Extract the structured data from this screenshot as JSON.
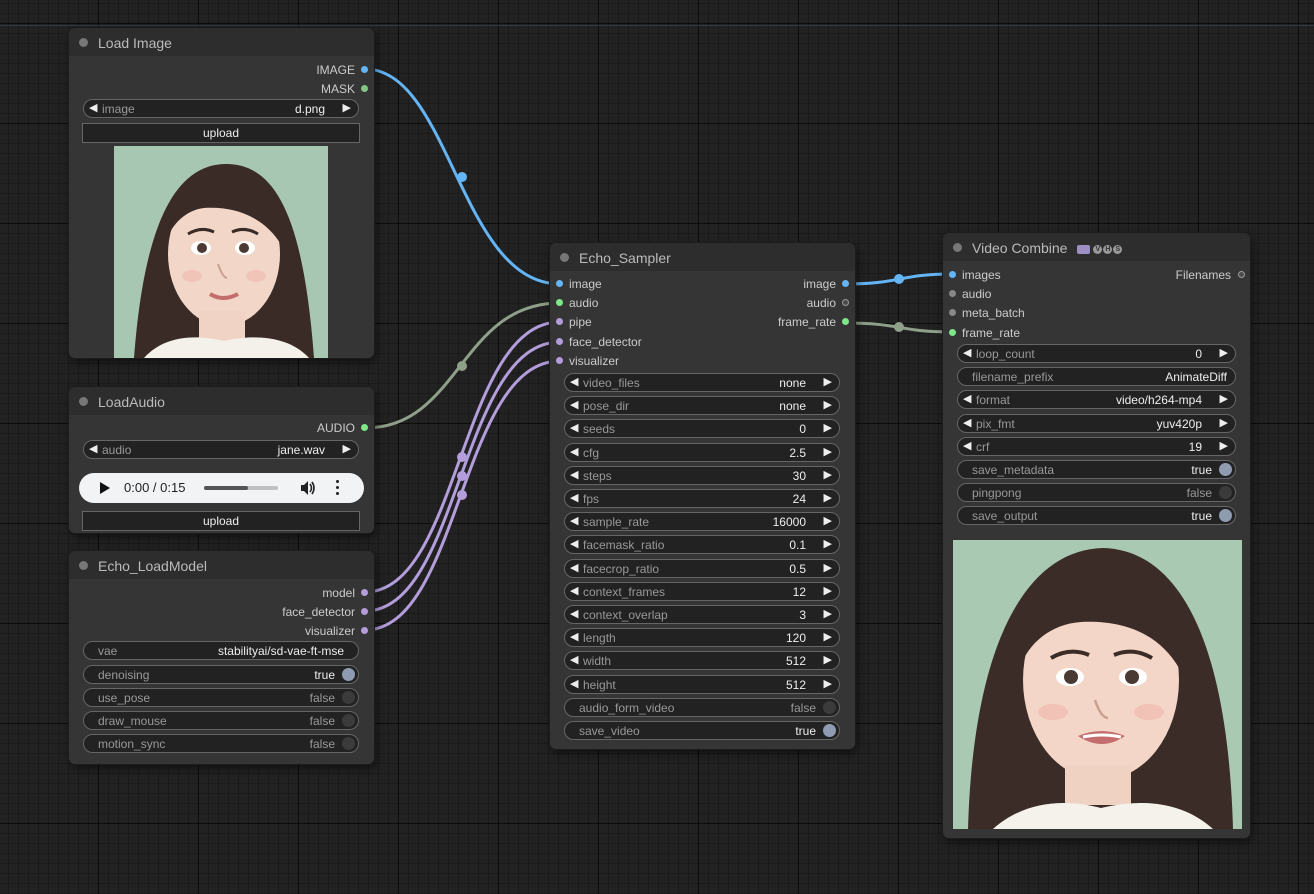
{
  "nodes": {
    "load_image": {
      "title": "Load Image",
      "outputs": [
        "IMAGE",
        "MASK"
      ],
      "image_widget": {
        "name": "image",
        "value": "d.png"
      },
      "upload_label": "upload"
    },
    "load_audio": {
      "title": "LoadAudio",
      "outputs": [
        "AUDIO"
      ],
      "audio_widget": {
        "name": "audio",
        "value": "jane.wav"
      },
      "player_time": "0:00 / 0:15",
      "player_progress": 0.6,
      "upload_label": "upload"
    },
    "load_model": {
      "title": "Echo_LoadModel",
      "outputs": [
        "model",
        "face_detector",
        "visualizer"
      ],
      "widgets": [
        {
          "name": "vae",
          "value": "stabilityai/sd-vae-ft-mse"
        },
        {
          "name": "denoising",
          "value": "true"
        },
        {
          "name": "use_pose",
          "value": "false"
        },
        {
          "name": "draw_mouse",
          "value": "false"
        },
        {
          "name": "motion_sync",
          "value": "false"
        }
      ]
    },
    "sampler": {
      "title": "Echo_Sampler",
      "inputs": [
        "image",
        "audio",
        "pipe",
        "face_detector",
        "visualizer"
      ],
      "outputs": [
        "image",
        "audio",
        "frame_rate"
      ],
      "widgets": [
        {
          "name": "video_files",
          "value": "none"
        },
        {
          "name": "pose_dir",
          "value": "none"
        },
        {
          "name": "seeds",
          "value": "0"
        },
        {
          "name": "cfg",
          "value": "2.5"
        },
        {
          "name": "steps",
          "value": "30"
        },
        {
          "name": "fps",
          "value": "24"
        },
        {
          "name": "sample_rate",
          "value": "16000"
        },
        {
          "name": "facemask_ratio",
          "value": "0.1"
        },
        {
          "name": "facecrop_ratio",
          "value": "0.5"
        },
        {
          "name": "context_frames",
          "value": "12"
        },
        {
          "name": "context_overlap",
          "value": "3"
        },
        {
          "name": "length",
          "value": "120"
        },
        {
          "name": "width",
          "value": "512"
        },
        {
          "name": "height",
          "value": "512"
        },
        {
          "name": "audio_form_video",
          "value": "false"
        },
        {
          "name": "save_video",
          "value": "true"
        }
      ]
    },
    "video_combine": {
      "title": "Video Combine",
      "badge_letters": [
        "V",
        "H",
        "S"
      ],
      "inputs": [
        "images",
        "audio",
        "meta_batch",
        "frame_rate"
      ],
      "outputs": [
        "Filenames"
      ],
      "widgets": [
        {
          "name": "loop_count",
          "value": "0"
        },
        {
          "name": "filename_prefix",
          "value": "AnimateDiff"
        },
        {
          "name": "format",
          "value": "video/h264-mp4"
        },
        {
          "name": "pix_fmt",
          "value": "yuv420p"
        },
        {
          "name": "crf",
          "value": "19"
        },
        {
          "name": "save_metadata",
          "value": "true"
        },
        {
          "name": "pingpong",
          "value": "false"
        },
        {
          "name": "save_output",
          "value": "true"
        }
      ]
    }
  },
  "colors": {
    "image_wire": "#64b5f6",
    "audio_wire": "#8fa08a",
    "pipe_wire": "#b39ddb",
    "background": "#222222",
    "node_body": "#353535"
  },
  "icons": {
    "play": "play-icon",
    "volume": "volume-icon",
    "more": "more-vert-icon",
    "arrow_left": "arrow-left-icon",
    "arrow_right": "arrow-right-icon"
  }
}
